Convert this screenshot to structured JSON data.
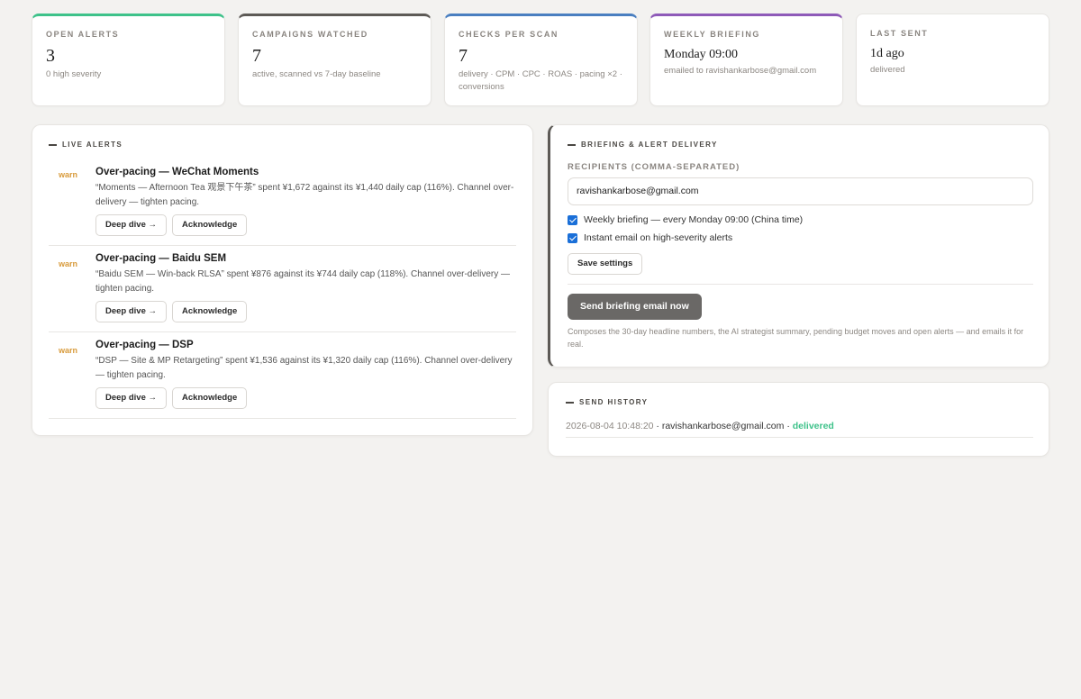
{
  "stats": [
    {
      "label": "OPEN ALERTS",
      "value": "3",
      "sub": "0 high severity",
      "accent": "#3ec28a"
    },
    {
      "label": "CAMPAIGNS WATCHED",
      "value": "7",
      "sub": "active, scanned vs 7-day baseline",
      "accent": "#5d5a56"
    },
    {
      "label": "CHECKS PER SCAN",
      "value": "7",
      "sub": "delivery · CPM · CPC · ROAS · pacing ×2 · conversions",
      "accent": "#4a7fc0"
    },
    {
      "label": "WEEKLY BRIEFING",
      "value": "Monday 09:00",
      "sub": "emailed to ravishankarbose@gmail.com",
      "accent": "#8e5ab8"
    },
    {
      "label": "LAST SENT",
      "value": "1d ago",
      "sub": "delivered"
    }
  ],
  "alerts_panel": {
    "title": "LIVE ALERTS",
    "items": [
      {
        "severity": "warn",
        "title": "Over-pacing — WeChat Moments",
        "description": "“Moments — Afternoon Tea 观景下午茶” spent ¥1,672 against its ¥1,440 daily cap (116%). Channel over-delivery — tighten pacing.",
        "deep_dive": "Deep dive →",
        "acknowledge": "Acknowledge"
      },
      {
        "severity": "warn",
        "title": "Over-pacing — Baidu SEM",
        "description": "“Baidu SEM — Win-back RLSA” spent ¥876 against its ¥744 daily cap (118%). Channel over-delivery — tighten pacing.",
        "deep_dive": "Deep dive →",
        "acknowledge": "Acknowledge"
      },
      {
        "severity": "warn",
        "title": "Over-pacing — DSP",
        "description": "“DSP — Site & MP Retargeting” spent ¥1,536 against its ¥1,320 daily cap (116%). Channel over-delivery — tighten pacing.",
        "deep_dive": "Deep dive →",
        "acknowledge": "Acknowledge"
      }
    ]
  },
  "briefing": {
    "title": "BRIEFING & ALERT DELIVERY",
    "recipients_label": "RECIPIENTS (COMMA-SEPARATED)",
    "recipients_value": "ravishankarbose@gmail.com",
    "weekly_label": "Weekly briefing — every Monday 09:00 (China time)",
    "weekly_checked": true,
    "instant_label": "Instant email on high-severity alerts",
    "instant_checked": true,
    "save_label": "Save settings",
    "send_label": "Send briefing email now",
    "note": "Composes the 30-day headline numbers, the AI strategist summary, pending budget moves and open alerts — and emails it for real."
  },
  "history": {
    "title": "SEND HISTORY",
    "entries": [
      {
        "timestamp": "2026-08-04 10:48:20",
        "recipient": "ravishankarbose@gmail.com",
        "status": "delivered"
      }
    ]
  }
}
